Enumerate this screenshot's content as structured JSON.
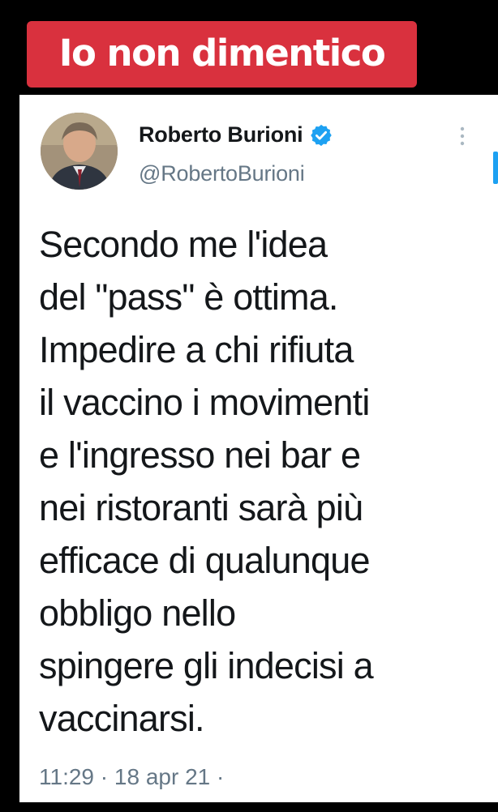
{
  "banner": {
    "text": "Io non dimentico",
    "color": "#d9313e"
  },
  "tweet": {
    "author_name": "Roberto Burioni",
    "handle": "@RobertoBurioni",
    "verified": true,
    "verified_icon": "verified-badge-icon",
    "more_icon": "more-options-icon",
    "avatar_icon": "profile-photo",
    "text": "Secondo me l'idea\ndel \"pass\" è ottima.\nImpedire a chi rifiuta\nil vaccino i movimenti\ne l'ingresso nei bar e\nnei ristoranti sarà più\nefficace di qualunque\nobbligo nello\nspingere gli indecisi a\nvaccinarsi.",
    "time": "11:29",
    "separator": "·",
    "date": "18 apr 21",
    "trailing_separator": "·"
  },
  "colors": {
    "background": "#000000",
    "card": "#ffffff",
    "text_primary": "#14171a",
    "text_secondary": "#657786",
    "verified": "#1da1f2"
  }
}
